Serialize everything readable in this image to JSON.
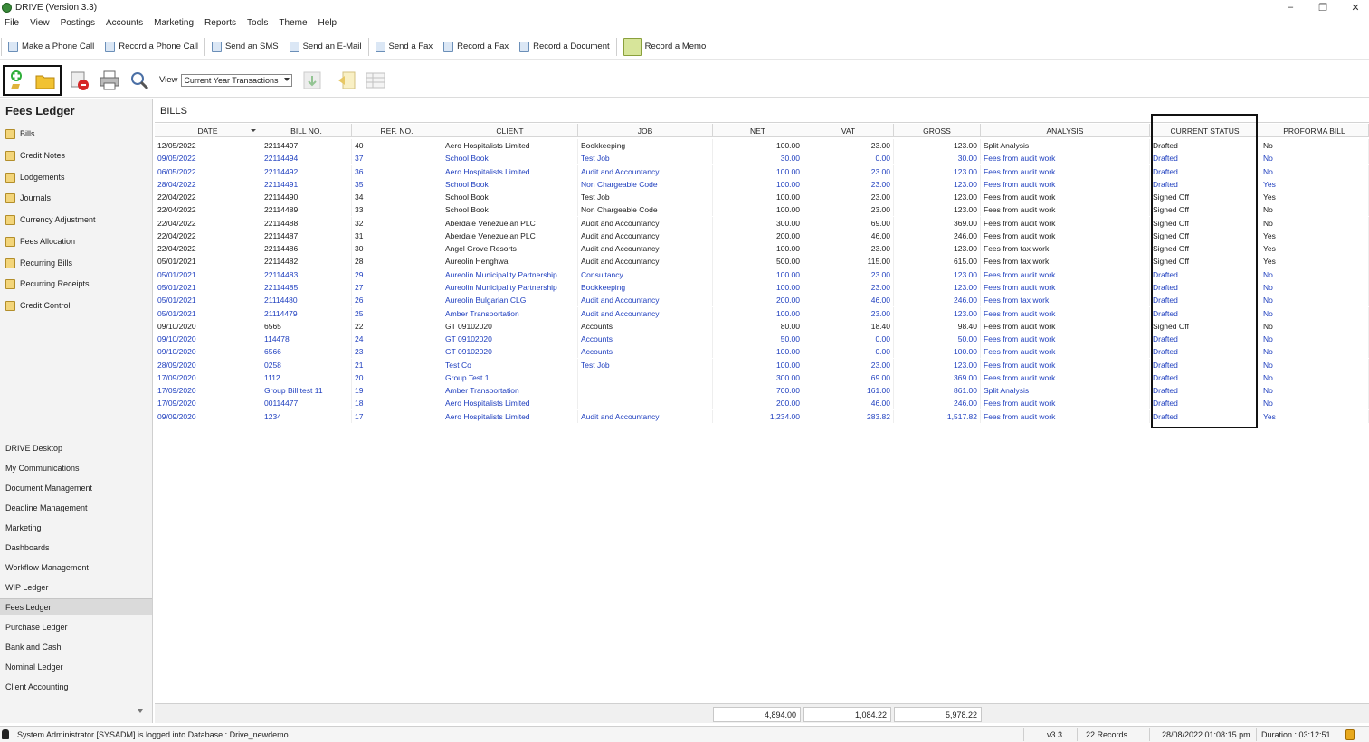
{
  "window": {
    "title": "DRIVE (Version 3.3)"
  },
  "menu": [
    "File",
    "View",
    "Postings",
    "Accounts",
    "Marketing",
    "Reports",
    "Tools",
    "Theme",
    "Help"
  ],
  "comm_toolbar": [
    {
      "label": "Make a Phone Call",
      "icon": "phone-call-icon"
    },
    {
      "label": "Record a Phone Call",
      "icon": "record-call-icon"
    },
    {
      "label": "Send an SMS",
      "icon": "sms-icon"
    },
    {
      "label": "Send an E-Mail",
      "icon": "email-icon"
    },
    {
      "label": "Send a Fax",
      "icon": "fax-icon"
    },
    {
      "label": "Record a Fax",
      "icon": "record-fax-icon"
    },
    {
      "label": "Record a Document",
      "icon": "document-icon"
    },
    {
      "label": "Record a Memo",
      "icon": "memo-icon"
    }
  ],
  "action_toolbar": {
    "view_label": "View",
    "view_value": "Current Year Transactions"
  },
  "sidebar": {
    "title": "Fees Ledger",
    "items": [
      "Bills",
      "Credit Notes",
      "Lodgements",
      "Journals",
      "Currency Adjustment",
      "Fees Allocation",
      "Recurring Bills",
      "Recurring Receipts",
      "Credit Control"
    ],
    "nav": [
      "DRIVE Desktop",
      "My Communications",
      "Document Management",
      "Deadline Management",
      "Marketing",
      "Dashboards",
      "Workflow Management",
      "WIP Ledger",
      "Fees Ledger",
      "Purchase Ledger",
      "Bank and Cash",
      "Nominal Ledger",
      "Client Accounting"
    ],
    "active_nav": "Fees Ledger"
  },
  "grid": {
    "title": "BILLS",
    "columns": [
      "DATE",
      "BILL NO.",
      "REF. NO.",
      "CLIENT",
      "JOB",
      "NET",
      "VAT",
      "GROSS",
      "ANALYSIS",
      "CURRENT STATUS",
      "PROFORMA BILL"
    ],
    "rows": [
      [
        "12/05/2022",
        "22114497",
        "40",
        "Aero Hospitalists Limited",
        "Bookkeeping",
        "100.00",
        "23.00",
        "123.00",
        "Split Analysis",
        "Drafted",
        "No",
        "black"
      ],
      [
        "09/05/2022",
        "22114494",
        "37",
        "School Book",
        "Test Job",
        "30.00",
        "0.00",
        "30.00",
        "Fees from audit work",
        "Drafted",
        "No",
        "blue"
      ],
      [
        "06/05/2022",
        "22114492",
        "36",
        "Aero Hospitalists Limited",
        "Audit and Accountancy",
        "100.00",
        "23.00",
        "123.00",
        "Fees from audit work",
        "Drafted",
        "No",
        "blue"
      ],
      [
        "28/04/2022",
        "22114491",
        "35",
        "School Book",
        "Non Chargeable Code",
        "100.00",
        "23.00",
        "123.00",
        "Fees from audit work",
        "Drafted",
        "Yes",
        "blue"
      ],
      [
        "22/04/2022",
        "22114490",
        "34",
        "School Book",
        "Test Job",
        "100.00",
        "23.00",
        "123.00",
        "Fees from audit work",
        "Signed Off",
        "Yes",
        "black"
      ],
      [
        "22/04/2022",
        "22114489",
        "33",
        "School Book",
        "Non Chargeable Code",
        "100.00",
        "23.00",
        "123.00",
        "Fees from audit work",
        "Signed Off",
        "No",
        "black"
      ],
      [
        "22/04/2022",
        "22114488",
        "32",
        "Aberdale Venezuelan PLC",
        "Audit and Accountancy",
        "300.00",
        "69.00",
        "369.00",
        "Fees from audit work",
        "Signed Off",
        "No",
        "black"
      ],
      [
        "22/04/2022",
        "22114487",
        "31",
        "Aberdale Venezuelan PLC",
        "Audit and Accountancy",
        "200.00",
        "46.00",
        "246.00",
        "Fees from audit work",
        "Signed Off",
        "Yes",
        "black"
      ],
      [
        "22/04/2022",
        "22114486",
        "30",
        "Angel Grove Resorts",
        "Audit and Accountancy",
        "100.00",
        "23.00",
        "123.00",
        "Fees from tax work",
        "Signed Off",
        "Yes",
        "black"
      ],
      [
        "05/01/2021",
        "22114482",
        "28",
        "Aureolin Henghwa",
        "Audit and Accountancy",
        "500.00",
        "115.00",
        "615.00",
        "Fees from tax work",
        "Signed Off",
        "Yes",
        "black"
      ],
      [
        "05/01/2021",
        "22114483",
        "29",
        "Aureolin Municipality Partnership",
        "Consultancy",
        "100.00",
        "23.00",
        "123.00",
        "Fees from audit work",
        "Drafted",
        "No",
        "blue"
      ],
      [
        "05/01/2021",
        "22114485",
        "27",
        "Aureolin Municipality Partnership",
        "Bookkeeping",
        "100.00",
        "23.00",
        "123.00",
        "Fees from audit work",
        "Drafted",
        "No",
        "blue"
      ],
      [
        "05/01/2021",
        "21114480",
        "26",
        "Aureolin Bulgarian CLG",
        "Audit and Accountancy",
        "200.00",
        "46.00",
        "246.00",
        "Fees from tax work",
        "Drafted",
        "No",
        "blue"
      ],
      [
        "05/01/2021",
        "21114479",
        "25",
        "Amber Transportation",
        "Audit and Accountancy",
        "100.00",
        "23.00",
        "123.00",
        "Fees from audit work",
        "Drafted",
        "No",
        "blue"
      ],
      [
        "09/10/2020",
        "6565",
        "22",
        "GT 09102020",
        "Accounts",
        "80.00",
        "18.40",
        "98.40",
        "Fees from audit work",
        "Signed Off",
        "No",
        "black"
      ],
      [
        "09/10/2020",
        "114478",
        "24",
        "GT 09102020",
        "Accounts",
        "50.00",
        "0.00",
        "50.00",
        "Fees from audit work",
        "Drafted",
        "No",
        "blue"
      ],
      [
        "09/10/2020",
        "6566",
        "23",
        "GT 09102020",
        "Accounts",
        "100.00",
        "0.00",
        "100.00",
        "Fees from audit work",
        "Drafted",
        "No",
        "blue"
      ],
      [
        "28/09/2020",
        "0258",
        "21",
        "Test Co",
        "Test Job",
        "100.00",
        "23.00",
        "123.00",
        "Fees from audit work",
        "Drafted",
        "No",
        "blue"
      ],
      [
        "17/09/2020",
        "1112",
        "20",
        "Group Test 1",
        "",
        "300.00",
        "69.00",
        "369.00",
        "Fees from audit work",
        "Drafted",
        "No",
        "blue"
      ],
      [
        "17/09/2020",
        "Group Bill test 11",
        "19",
        "Amber Transportation",
        "",
        "700.00",
        "161.00",
        "861.00",
        "Split Analysis",
        "Drafted",
        "No",
        "blue"
      ],
      [
        "17/09/2020",
        "00114477",
        "18",
        "Aero Hospitalists Limited",
        "",
        "200.00",
        "46.00",
        "246.00",
        "Fees from audit work",
        "Drafted",
        "No",
        "blue"
      ],
      [
        "09/09/2020",
        "1234",
        "17",
        "Aero Hospitalists Limited",
        "Audit and Accountancy",
        "1,234.00",
        "283.82",
        "1,517.82",
        "Fees from audit work",
        "Drafted",
        "Yes",
        "blue"
      ]
    ]
  },
  "totals": {
    "net": "4,894.00",
    "vat": "1,084.22",
    "gross": "5,978.22"
  },
  "statusbar": {
    "user_text": "System Administrator [SYSADM] is logged into Database : Drive_newdemo",
    "version": "v3.3",
    "records": "22 Records",
    "datetime": "28/08/2022 01:08:15 pm",
    "duration": "Duration : 03:12:51"
  },
  "colors": {
    "link_blue": "#1f3fbf",
    "sidebar_bg": "#f3f3f3",
    "active_nav": "#dadada"
  }
}
